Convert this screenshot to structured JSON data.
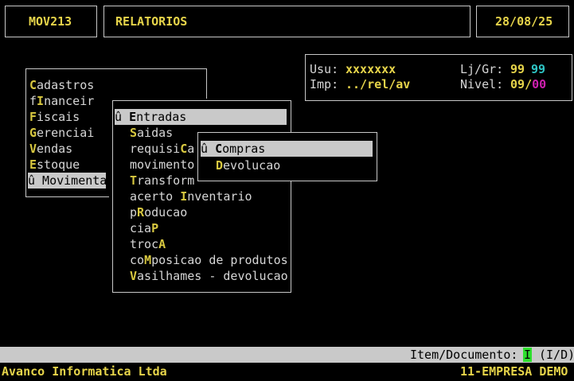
{
  "header": {
    "program": "MOV213",
    "module": "RELATORIOS",
    "date": "28/08/25"
  },
  "info": {
    "user_label": "Usu:",
    "user_value": "xxxxxxx",
    "store_label": "Lj/Gr:",
    "store_value": "99",
    "group_value": "99",
    "printer_label": "Imp:",
    "printer_value": "../rel/av",
    "level_label": "Nivel:",
    "level_value": "09",
    "level_sep": "/",
    "level_value2": "00"
  },
  "main_menu": {
    "items": [
      {
        "pre": "",
        "key": "C",
        "post": "adastros"
      },
      {
        "pre": "f",
        "key": "I",
        "post": "nanceir"
      },
      {
        "pre": "",
        "key": "F",
        "post": "iscais"
      },
      {
        "pre": "",
        "key": "G",
        "post": "erenciai"
      },
      {
        "pre": "",
        "key": "V",
        "post": "endas"
      },
      {
        "pre": "",
        "key": "E",
        "post": "stoque"
      },
      {
        "pre": "û Movimenta",
        "key": "",
        "post": ""
      }
    ]
  },
  "sub_menu": {
    "items": [
      {
        "pre": "û ",
        "key": "E",
        "post": "ntradas"
      },
      {
        "pre": "",
        "key": "S",
        "post": "aidas"
      },
      {
        "pre": "requisi",
        "key": "C",
        "post": "a"
      },
      {
        "pre": "movimento",
        "key": "",
        "post": ""
      },
      {
        "pre": "",
        "key": "T",
        "post": "ransform"
      },
      {
        "pre": "acerto ",
        "key": "I",
        "post": "nventario"
      },
      {
        "pre": "p",
        "key": "R",
        "post": "oducao"
      },
      {
        "pre": "cia",
        "key": "P",
        "post": ""
      },
      {
        "pre": "troc",
        "key": "A",
        "post": ""
      },
      {
        "pre": "co",
        "key": "M",
        "post": "posicao de produtos"
      },
      {
        "pre": "",
        "key": "V",
        "post": "asilhames - devolucao"
      }
    ]
  },
  "sub_sub_menu": {
    "items": [
      {
        "pre": "û ",
        "key": "C",
        "post": "ompras"
      },
      {
        "pre": "",
        "key": "D",
        "post": "evolucao"
      }
    ]
  },
  "status": {
    "prompt": "Item/Documento:",
    "value": "I",
    "options": "(I/D)"
  },
  "footer": {
    "company": "Avanco Informatica Ltda",
    "enterprise": "11-EMPRESA DEMO"
  }
}
